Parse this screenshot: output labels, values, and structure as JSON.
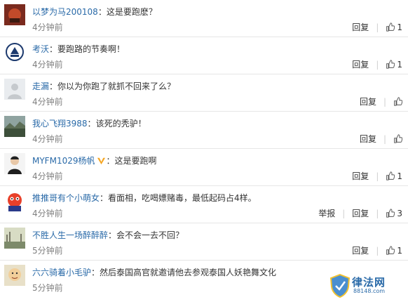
{
  "comments": [
    {
      "username": "以梦为马200108",
      "content": "这是要跑麽？",
      "time": "4分钟前",
      "reply": "回复",
      "likes": "1"
    },
    {
      "username": "考沃",
      "content": "要跑路的节奏啊！",
      "time": "4分钟前",
      "reply": "回复",
      "likes": "1"
    },
    {
      "username": "走漏",
      "content": "你以为你跑了就抓不回来了么？",
      "time": "4分钟前",
      "reply": "回复"
    },
    {
      "username": "我心飞翔3988",
      "content": "该死的秃驴！",
      "time": "4分钟前",
      "reply": "回复"
    },
    {
      "username": "MYFM1029杨帆",
      "content": "这是要跑啊",
      "time": "4分钟前",
      "reply": "回复",
      "likes": "1",
      "verified": true
    },
    {
      "username": "推推哥有个小萌女",
      "content": "看面相，吃喝嫖赌毒，最低起码占4样。",
      "time": "4分钟前",
      "report": "举报",
      "reply": "回复",
      "likes": "3"
    },
    {
      "username": "不胜人生一场醉醉醉",
      "content": "会不会一去不回？",
      "time": "5分钟前",
      "reply": "回复",
      "likes": "1"
    },
    {
      "username": "六六骑着小毛驴",
      "content": "然后泰国高官就邀请他去参观泰国人妖艳舞文化",
      "time": "5分钟前"
    }
  ],
  "separator": "：",
  "watermark": {
    "title": "律法网",
    "sub": "88148.com"
  },
  "colors": {
    "link": "#2a6aa8",
    "time": "#808080",
    "divider": "#e6e6e6",
    "verified": "#f5a623"
  }
}
